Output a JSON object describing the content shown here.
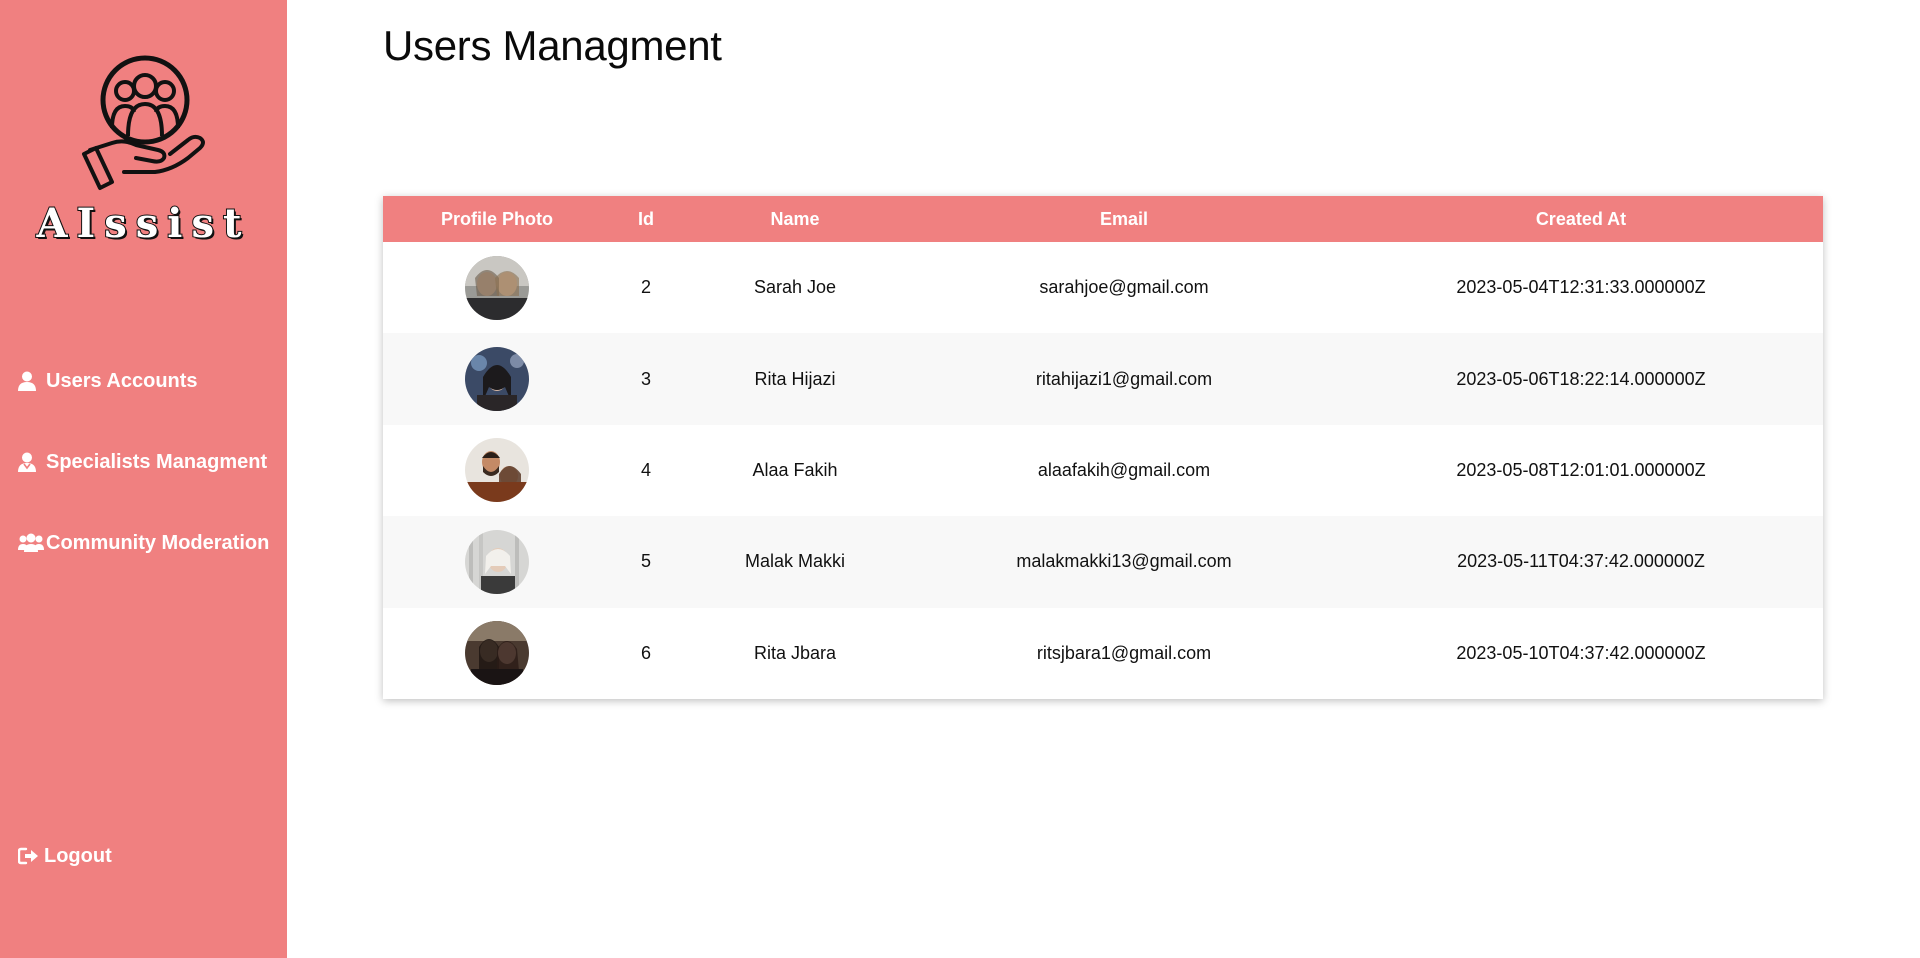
{
  "sidebar": {
    "brand": "AIssist",
    "logo_icon": "people-in-hand-icon",
    "nav": [
      {
        "label": "Users Accounts",
        "icon": "user-icon"
      },
      {
        "label": "Specialists Managment",
        "icon": "specialist-icon"
      },
      {
        "label": "Community Moderation",
        "icon": "users-group-icon"
      }
    ],
    "logout": {
      "label": "Logout",
      "icon": "sign-out-icon"
    }
  },
  "page": {
    "title": "Users Managment"
  },
  "table": {
    "headers": [
      "Profile Photo",
      "Id",
      "Name",
      "Email",
      "Created At"
    ],
    "rows": [
      {
        "id": "2",
        "name": "Sarah Joe",
        "email": "sarahjoe@gmail.com",
        "created_at": "2023-05-04T12:31:33.000000Z"
      },
      {
        "id": "3",
        "name": "Rita Hijazi",
        "email": "ritahijazi1@gmail.com",
        "created_at": "2023-05-06T18:22:14.000000Z"
      },
      {
        "id": "4",
        "name": "Alaa Fakih",
        "email": "alaafakih@gmail.com",
        "created_at": "2023-05-08T12:01:01.000000Z"
      },
      {
        "id": "5",
        "name": "Malak Makki",
        "email": "malakmakki13@gmail.com",
        "created_at": "2023-05-11T04:37:42.000000Z"
      },
      {
        "id": "6",
        "name": "Rita Jbara",
        "email": "ritsjbara1@gmail.com",
        "created_at": "2023-05-10T04:37:42.000000Z"
      }
    ]
  },
  "colors": {
    "accent": "#f08080",
    "sidebar_text": "#ffffff",
    "row_alt": "#f8f8f8"
  }
}
